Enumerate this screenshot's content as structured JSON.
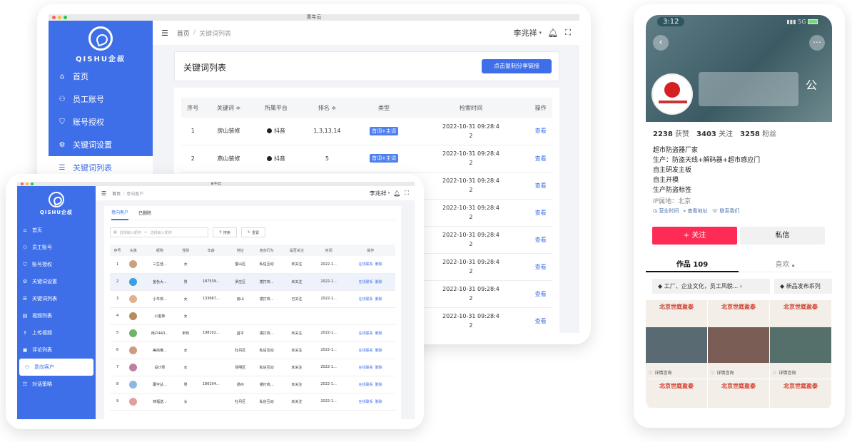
{
  "back_app": {
    "window_title": "青牛云",
    "logo_text": "QISHU企叔",
    "nav": [
      {
        "label": "首页",
        "icon": "home-icon"
      },
      {
        "label": "员工账号",
        "icon": "user-icon"
      },
      {
        "label": "账号授权",
        "icon": "shield-icon"
      },
      {
        "label": "关键词设置",
        "icon": "gear-icon"
      },
      {
        "label": "关键词列表",
        "icon": "list-icon"
      }
    ],
    "breadcrumb": {
      "home": "首页",
      "sep": "/",
      "current": "关键词列表"
    },
    "user": "李兆祥",
    "page_title": "关键词列表",
    "share_button": "点击复制分享链接",
    "columns": [
      "序号",
      "关键词 ≑",
      "所属平台",
      "排名 ≑",
      "类型",
      "检索时间",
      "操作"
    ],
    "rows": [
      {
        "no": "1",
        "keyword": "房山装修",
        "platform": "抖音",
        "rank": "1,3,13,14",
        "type": "首词+主词",
        "time1": "2022-10-31 09:28:4",
        "time2": "2",
        "action": "查看"
      },
      {
        "no": "2",
        "keyword": "燕山装修",
        "platform": "抖音",
        "rank": "5",
        "type": "首词+主词",
        "time1": "2022-10-31 09:28:4",
        "time2": "2",
        "action": "查看"
      },
      {
        "no": "",
        "keyword": "",
        "platform": "",
        "rank": "",
        "type": "+主词",
        "time1": "2022-10-31 09:28:4",
        "time2": "2",
        "action": "查看"
      },
      {
        "no": "",
        "keyword": "",
        "platform": "",
        "rank": "",
        "type": "+主词",
        "time1": "2022-10-31 09:28:4",
        "time2": "2",
        "action": "查看"
      },
      {
        "no": "",
        "keyword": "",
        "platform": "",
        "rank": "",
        "type": "+主词",
        "time1": "2022-10-31 09:28:4",
        "time2": "2",
        "action": "查看"
      },
      {
        "no": "",
        "keyword": "",
        "platform": "",
        "rank": "",
        "type": "+主词",
        "time1": "2022-10-31 09:28:4",
        "time2": "2",
        "action": "查看"
      },
      {
        "no": "",
        "keyword": "",
        "platform": "",
        "rank": "",
        "type": "+主词",
        "time1": "2022-10-31 09:28:4",
        "time2": "2",
        "action": "查看"
      },
      {
        "no": "",
        "keyword": "",
        "platform": "",
        "rank": "",
        "type": "+主词",
        "time1": "2022-10-31 09:28:4",
        "time2": "2",
        "action": "查看"
      }
    ]
  },
  "front_app": {
    "window_title": "青牛云",
    "logo_text": "QISHU企叔",
    "nav": [
      {
        "label": "首页",
        "icon": "home-icon"
      },
      {
        "label": "员工账号",
        "icon": "user-icon"
      },
      {
        "label": "账号授权",
        "icon": "shield-icon"
      },
      {
        "label": "关键词设置",
        "icon": "gear-icon"
      },
      {
        "label": "关键词列表",
        "icon": "list-icon"
      },
      {
        "label": "视频列表",
        "icon": "video-icon"
      },
      {
        "label": "上传视频",
        "icon": "upload-icon"
      },
      {
        "label": "评论列表",
        "icon": "comment-icon"
      },
      {
        "label": "意向客户",
        "icon": "customer-icon"
      },
      {
        "label": "对话策略",
        "icon": "chat-icon"
      }
    ],
    "active_index": 8,
    "breadcrumb": {
      "home": "首页",
      "sep": "/",
      "current": "意向客户"
    },
    "user": "李兆祥",
    "tabs": [
      "意向客户",
      "已删除"
    ],
    "search": {
      "start_placeholder": "选择输入昵称",
      "sep": "—",
      "end_placeholder": "选择输入昵称",
      "search_button": "搜索",
      "reset_button": "重置"
    },
    "columns": [
      "序号",
      "头像",
      "昵称",
      "性别",
      "年龄",
      "地址",
      "意向行为",
      "是否关注",
      "时间",
      "操作"
    ],
    "rows": [
      {
        "no": "1",
        "name": "三生佳...",
        "gender": "女",
        "age": "",
        "addr": "蜀山区",
        "behavior": "私信互动",
        "follow": "未关注",
        "time": "2022-1...",
        "a1": "在线联系",
        "a2": "删除",
        "avatar": "#c9a27d"
      },
      {
        "no": "2",
        "name": "金色大...",
        "gender": "男",
        "age": "187539...",
        "addr": "罗庄区",
        "behavior": "拨打商...",
        "follow": "未关注",
        "time": "2022-1...",
        "a1": "在线联系",
        "a2": "删除",
        "avatar": "#3aa0e0"
      },
      {
        "no": "3",
        "name": "小羊羔...",
        "gender": "女",
        "age": "133667...",
        "addr": "房山",
        "behavior": "拨打商...",
        "follow": "已关注",
        "time": "2022-1...",
        "a1": "在线联系",
        "a2": "删除",
        "avatar": "#e0b090"
      },
      {
        "no": "4",
        "name": "小金妹",
        "gender": "女",
        "age": "",
        "addr": "",
        "behavior": "",
        "follow": "",
        "time": "",
        "a1": "",
        "a2": "",
        "avatar": "#b88a60"
      },
      {
        "no": "5",
        "name": "用户443...",
        "gender": "未知",
        "age": "198102...",
        "addr": "昌平",
        "behavior": "拨打商...",
        "follow": "未关注",
        "time": "2022-1...",
        "a1": "在线联系",
        "a2": "删除",
        "avatar": "#6fb36b"
      },
      {
        "no": "6",
        "name": "美尚琳...",
        "gender": "女",
        "age": "",
        "addr": "牡丹区",
        "behavior": "私信互动",
        "follow": "未关注",
        "time": "2022-1...",
        "a1": "在线联系",
        "a2": "删除",
        "avatar": "#d09a80"
      },
      {
        "no": "7",
        "name": "设计师",
        "gender": "女",
        "age": "",
        "addr": "昆明区",
        "behavior": "私信互动",
        "follow": "未关注",
        "time": "2022-1...",
        "a1": "在线联系",
        "a2": "删除",
        "avatar": "#c07fa0"
      },
      {
        "no": "8",
        "name": "厦字丛...",
        "gender": "男",
        "age": "186104...",
        "addr": "通州",
        "behavior": "拨打商...",
        "follow": "未关注",
        "time": "2022-1...",
        "a1": "在线联系",
        "a2": "删除",
        "avatar": "#8fb8e0"
      },
      {
        "no": "9",
        "name": "抹福送...",
        "gender": "女",
        "age": "",
        "addr": "牡丹区",
        "behavior": "私信互动",
        "follow": "未关注",
        "time": "2022-1...",
        "a1": "在线联系",
        "a2": "删除",
        "avatar": "#e0a0a0"
      }
    ]
  },
  "phone": {
    "time": "3:12",
    "signal": "5G",
    "name_tail": "公",
    "stats": [
      {
        "num": "2238",
        "label": "获赞"
      },
      {
        "num": "3403",
        "label": "关注"
      },
      {
        "num": "3258",
        "label": "粉丝"
      }
    ],
    "bio": [
      "超市防盗器厂家",
      "生产：防盗天线+解码器+超市感应门",
      "自主研发主板",
      "自主开模",
      "生产防盗标签"
    ],
    "ip": "IP属地：北京",
    "chips": [
      "营业时间",
      "查看地址",
      "联系我们"
    ],
    "follow_button": "+ 关注",
    "message_button": "私信",
    "tabs": [
      {
        "label": "作品 109"
      },
      {
        "label": "喜欢"
      }
    ],
    "collections": [
      "工厂、企业文化，员工风貌...",
      "新品发布系列"
    ],
    "thumb_banner": "北京世庭盈泰",
    "thumb_caption": "详情咨询"
  },
  "colors": {
    "brand": "#3f6fe8",
    "follow": "#fe2c55"
  }
}
